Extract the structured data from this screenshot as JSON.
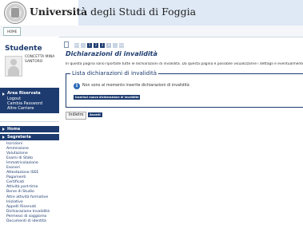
{
  "header": {
    "university_bold": "Università",
    "university_rest": " degli Studi di Foggia",
    "nav_home": "HOME"
  },
  "sidebar": {
    "title": "Studente",
    "student_name": "CONCETTA MINA SANTORO",
    "area_title": "Area Riservata",
    "area_items": [
      "Logout",
      "Cambia Password",
      "Altre Carriere"
    ],
    "home": "Home",
    "segreteria": "Segreteria",
    "segreteria_items": [
      "Iscrizioni",
      "Ammissione",
      "Valutazione",
      "Esami di Stato",
      "Immatricolazione",
      "Esoneri",
      "Attestazione ISEE",
      "Pagamenti",
      "Certificati",
      "Attività part-time",
      "Borse di Studio",
      "Altre attività formative",
      "Iniziative",
      "Appelli Riservati",
      "Dichiarazione Invalidità",
      "Permessi di soggiorno",
      "Documenti di identità"
    ]
  },
  "breadcrumb": {
    "steps": [
      "<<",
      "...",
      "1",
      "2",
      "3",
      "4",
      "...",
      ">>"
    ],
    "active": "2"
  },
  "main": {
    "title": "Dichiarazioni di invalidità",
    "intro": "In questa pagina sono riportate tutte le dichiarazioni di invalidità. Da questa pagina è possibile visualizzarne i dettagli e eventualmente modificarle.",
    "list_legend": "Lista dichiarazioni di invalidità",
    "info_message": "Non sono al momento inserite dichiarazioni di invalidità",
    "new_button": "Inserisci nuova dichiarazione di invalidità",
    "back_button": "Indietro",
    "next_button": "Avanti"
  },
  "colors": {
    "primary": "#1d3b6f",
    "header_band": "#dfe9f5",
    "info": "#2b6cb5"
  }
}
